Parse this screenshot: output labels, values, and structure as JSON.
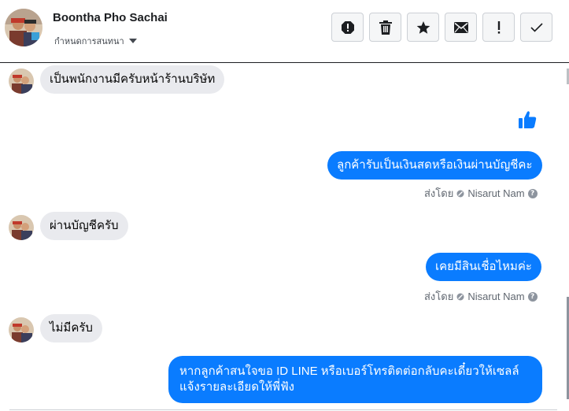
{
  "header": {
    "name": "Boontha Pho Sachai",
    "subtitle": "กำหนดการสนทนา",
    "toolbar": [
      {
        "name": "spam-report-button",
        "icon": "alert-octagon-icon"
      },
      {
        "name": "delete-button",
        "icon": "trash-icon"
      },
      {
        "name": "star-button",
        "icon": "star-icon"
      },
      {
        "name": "mark-unread-button",
        "icon": "envelope-icon"
      },
      {
        "name": "important-button",
        "icon": "exclamation-icon"
      },
      {
        "name": "done-button",
        "icon": "checkmark-icon"
      }
    ]
  },
  "messages": [
    {
      "from": "customer",
      "text": "เป็นพนักงานมีครับหน้าร้านบริษัท"
    },
    {
      "from": "page",
      "type": "like",
      "icon": "thumbs-up-icon"
    },
    {
      "from": "page",
      "text": "ลูกค้ารับเป็นเงินสดหรือเงินผ่านบัญชีคะ",
      "sent_prefix": "ส่งโดย",
      "sent_by": "Nisarut Nam"
    },
    {
      "from": "customer",
      "text": "ผ่านบัญชีครับ"
    },
    {
      "from": "page",
      "text": "เคยมีสินเชื่อไหมค่ะ",
      "sent_prefix": "ส่งโดย",
      "sent_by": "Nisarut Nam"
    },
    {
      "from": "customer",
      "text": "ไม่มีครับ"
    },
    {
      "from": "page",
      "text": "หากลูกค้าสนใจขอ ID LINE หรือเบอร์โทรติดต่อกลับคะเดี๋ยวให้เซลล์แจ้งรายละเอียดให้พี่ฟัง"
    }
  ],
  "colors": {
    "outgoing_bubble": "#0a7cff",
    "incoming_bubble": "#e9eaee",
    "like": "#0a7cff"
  }
}
